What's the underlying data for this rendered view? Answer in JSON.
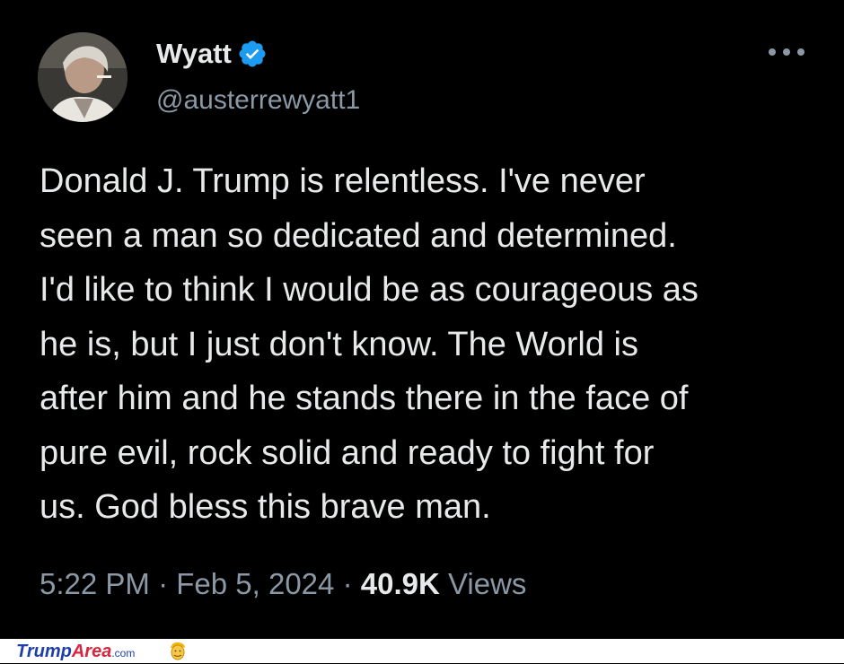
{
  "tweet": {
    "display_name": "Wyatt",
    "handle": "@austerrewyatt1",
    "text": "Donald J. Trump is relentless. I've never\nseen a man so dedicated and determined.\nI'd like to think I would be as courageous as\nhe is, but I just don't know. The World is\nafter him and he stands there in the face of\npure evil, rock solid and ready to fight for\nus. God bless this brave man.",
    "time": "5:22 PM",
    "separator": "·",
    "date": "Feb 5, 2024",
    "views_count": "40.9K",
    "views_label": "Views",
    "verified_icon": "verified-badge-icon",
    "more_icon": "more-options-icon"
  },
  "footer": {
    "brand_part1": "Trump",
    "brand_part2": "Area",
    "brand_part3": ".com",
    "logo_icon": "trump-face-icon"
  },
  "colors": {
    "background": "#000000",
    "text_primary": "#e7e9ea",
    "text_secondary": "#8b98a5",
    "verified_blue": "#1d9bf0",
    "brand_blue": "#1f3fa8",
    "brand_red": "#d7263d"
  }
}
